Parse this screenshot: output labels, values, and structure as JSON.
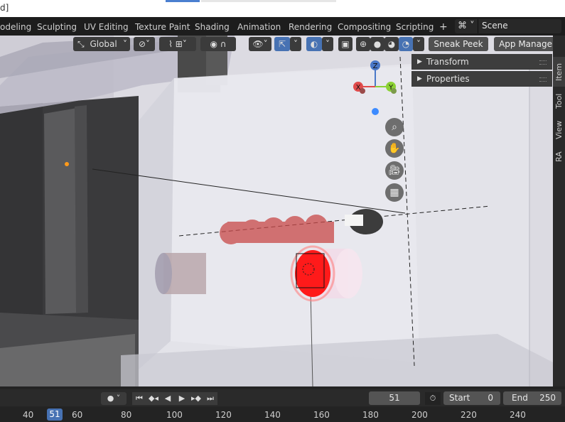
{
  "titlebar": {
    "text": "d]"
  },
  "workspace_tabs": [
    "odeling",
    "Sculpting",
    "UV Editing",
    "Texture Paint",
    "Shading",
    "Animation",
    "Rendering",
    "Compositing",
    "Scripting"
  ],
  "add_tab": "+",
  "scene": {
    "name": "Scene",
    "icon": "scene-icon"
  },
  "viewport_header": {
    "orientation": "Global",
    "sneak_peek": "Sneak Peek",
    "app_manager": "App Manager"
  },
  "n_panel": {
    "sections": [
      "Transform",
      "Properties"
    ],
    "tabs": [
      "Item",
      "Tool",
      "View",
      "RA"
    ]
  },
  "gizmo": {
    "z": "Z",
    "x": "X",
    "y": "Y"
  },
  "timeline": {
    "current_frame": "51",
    "start_label": "Start",
    "start_value": "0",
    "end_label": "End",
    "end_value": "250",
    "ticks": [
      "40",
      "60",
      "80",
      "100",
      "120",
      "140",
      "160",
      "180",
      "200",
      "220",
      "240"
    ]
  },
  "colors": {
    "accent": "#4772b3",
    "selected_red": "#ff1a1a",
    "axis_x": "#e04b4b",
    "axis_y": "#8bd134",
    "axis_z": "#4a78c8"
  }
}
